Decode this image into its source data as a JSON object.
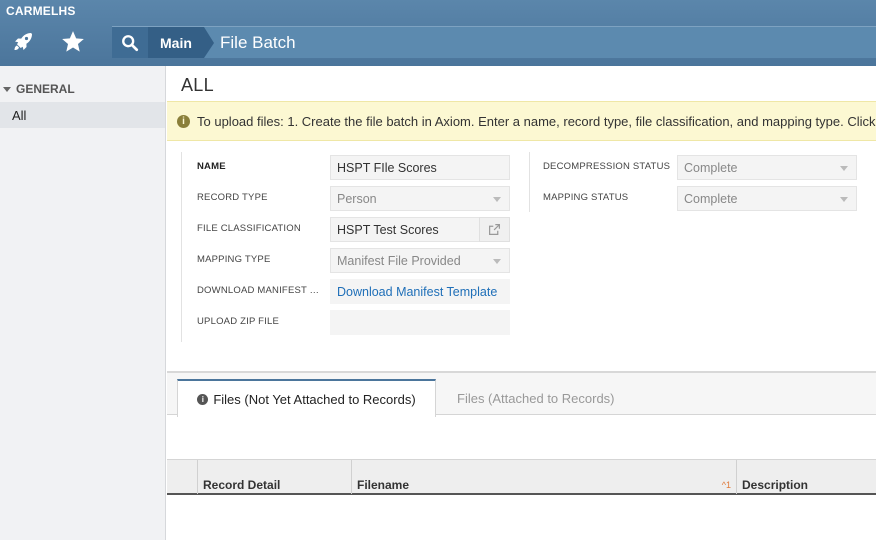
{
  "app": {
    "org_name": "CARMELHS"
  },
  "toolbar": {
    "rocket_icon": "rocket-icon",
    "star_icon": "star-icon",
    "search_icon": "search-icon"
  },
  "breadcrumb": {
    "main": "Main",
    "current": "File Batch"
  },
  "sidebar": {
    "section_title": "GENERAL",
    "items": [
      {
        "label": "All"
      }
    ]
  },
  "page": {
    "title": "ALL"
  },
  "info": {
    "text": "To upload files: 1. Create the file batch in Axiom. Enter a name, record type, file classification, and mapping type. Click"
  },
  "form": {
    "name_label": "NAME",
    "name_value": "HSPT FIle Scores",
    "record_type_label": "RECORD TYPE",
    "record_type_value": "Person",
    "file_classification_label": "FILE CLASSIFICATION",
    "file_classification_value": "HSPT Test Scores",
    "mapping_type_label": "MAPPING TYPE",
    "mapping_type_value": "Manifest File Provided",
    "download_manifest_label": "DOWNLOAD MANIFEST T...",
    "download_manifest_link": "Download Manifest Template",
    "upload_zip_label": "UPLOAD ZIP FILE",
    "upload_zip_value": "",
    "decompression_status_label": "DECOMPRESSION STATUS",
    "decompression_status_value": "Complete",
    "mapping_status_label": "MAPPING STATUS",
    "mapping_status_value": "Complete"
  },
  "tabs": [
    {
      "label": "Files (Not Yet Attached to Records)",
      "active": true
    },
    {
      "label": "Files (Attached to Records)",
      "active": false
    }
  ],
  "table": {
    "columns": [
      {
        "label": ""
      },
      {
        "label": "Record Detail"
      },
      {
        "label": "Filename",
        "sort": "1"
      },
      {
        "label": "Description"
      }
    ]
  },
  "colors": {
    "header_blue": "#4b759b",
    "breadcrumb_dark": "#345f86",
    "info_bg": "#fcf8d2",
    "link": "#1f6fb8",
    "sort_indicator": "#e07a3a"
  }
}
